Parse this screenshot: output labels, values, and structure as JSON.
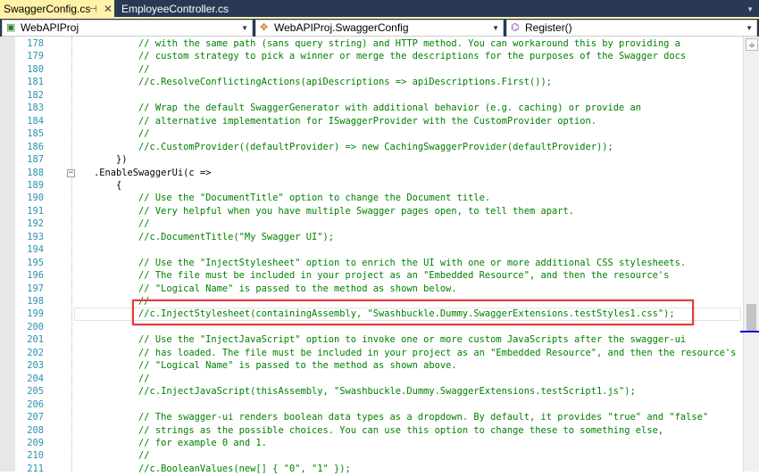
{
  "tabs": [
    {
      "label": "SwaggerConfig.cs",
      "active": true
    },
    {
      "label": "EmployeeController.cs",
      "active": false
    }
  ],
  "nav": {
    "project": "WebAPIProj",
    "class": "WebAPIProj.SwaggerConfig",
    "member": "Register()"
  },
  "current_line": 199,
  "lines": [
    {
      "n": "178",
      "t": "        // with the same path (sans query string) and HTTP method. You can workaround this by providing a",
      "c": true
    },
    {
      "n": "179",
      "t": "        // custom strategy to pick a winner or merge the descriptions for the purposes of the Swagger docs",
      "c": true
    },
    {
      "n": "180",
      "t": "        //",
      "c": true
    },
    {
      "n": "181",
      "t": "        //c.ResolveConflictingActions(apiDescriptions => apiDescriptions.First());",
      "c": true
    },
    {
      "n": "182",
      "t": "",
      "c": false
    },
    {
      "n": "183",
      "t": "        // Wrap the default SwaggerGenerator with additional behavior (e.g. caching) or provide an",
      "c": true
    },
    {
      "n": "184",
      "t": "        // alternative implementation for ISwaggerProvider with the CustomProvider option.",
      "c": true
    },
    {
      "n": "185",
      "t": "        //",
      "c": true
    },
    {
      "n": "186",
      "t": "        //c.CustomProvider((defaultProvider) => new CachingSwaggerProvider(defaultProvider));",
      "c": true
    },
    {
      "n": "187",
      "t": "    })",
      "c": false
    },
    {
      "n": "188",
      "t": ".EnableSwaggerUi(c =>",
      "c": false,
      "fold": "−"
    },
    {
      "n": "189",
      "t": "    {",
      "c": false
    },
    {
      "n": "190",
      "t": "        // Use the \"DocumentTitle\" option to change the Document title.",
      "c": true
    },
    {
      "n": "191",
      "t": "        // Very helpful when you have multiple Swagger pages open, to tell them apart.",
      "c": true
    },
    {
      "n": "192",
      "t": "        //",
      "c": true
    },
    {
      "n": "193",
      "t": "        //c.DocumentTitle(\"My Swagger UI\");",
      "c": true
    },
    {
      "n": "194",
      "t": "",
      "c": false
    },
    {
      "n": "195",
      "t": "        // Use the \"InjectStylesheet\" option to enrich the UI with one or more additional CSS stylesheets.",
      "c": true
    },
    {
      "n": "196",
      "t": "        // The file must be included in your project as an \"Embedded Resource\", and then the resource's",
      "c": true
    },
    {
      "n": "197",
      "t": "        // \"Logical Name\" is passed to the method as shown below.",
      "c": true
    },
    {
      "n": "198",
      "t": "        //",
      "c": true
    },
    {
      "n": "199",
      "t": "        //c.InjectStylesheet(containingAssembly, \"Swashbuckle.Dummy.SwaggerExtensions.testStyles1.css\");",
      "c": true
    },
    {
      "n": "200",
      "t": "",
      "c": false
    },
    {
      "n": "201",
      "t": "        // Use the \"InjectJavaScript\" option to invoke one or more custom JavaScripts after the swagger-ui",
      "c": true
    },
    {
      "n": "202",
      "t": "        // has loaded. The file must be included in your project as an \"Embedded Resource\", and then the resource's",
      "c": true
    },
    {
      "n": "203",
      "t": "        // \"Logical Name\" is passed to the method as shown above.",
      "c": true
    },
    {
      "n": "204",
      "t": "        //",
      "c": true
    },
    {
      "n": "205",
      "t": "        //c.InjectJavaScript(thisAssembly, \"Swashbuckle.Dummy.SwaggerExtensions.testScript1.js\");",
      "c": true
    },
    {
      "n": "206",
      "t": "",
      "c": false
    },
    {
      "n": "207",
      "t": "        // The swagger-ui renders boolean data types as a dropdown. By default, it provides \"true\" and \"false\"",
      "c": true
    },
    {
      "n": "208",
      "t": "        // strings as the possible choices. You can use this option to change these to something else,",
      "c": true
    },
    {
      "n": "209",
      "t": "        // for example 0 and 1.",
      "c": true
    },
    {
      "n": "210",
      "t": "        //",
      "c": true
    },
    {
      "n": "211",
      "t": "        //c.BooleanValues(new[] { \"0\", \"1\" });",
      "c": true
    }
  ]
}
